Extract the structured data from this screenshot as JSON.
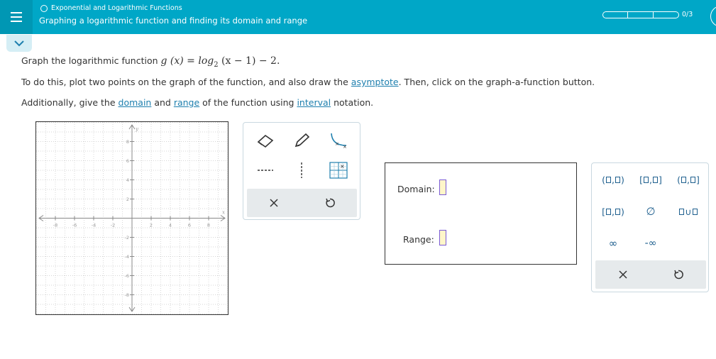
{
  "header": {
    "topic": "Exponential and Logarithmic Functions",
    "title": "Graphing a logarithmic function and finding its domain and range",
    "progress": "0/3"
  },
  "problem": {
    "line1_prefix": "Graph the logarithmic function ",
    "line1_func": "g (x) = log",
    "line1_base": "2",
    "line1_rest": " (x − 1) − 2.",
    "line2_a": "To do this, plot two points on the graph of the function, and also draw the ",
    "line2_link": "asymptote",
    "line2_b": ". Then, click on the graph-a-function button.",
    "line3_a": "Additionally, give the ",
    "line3_link1": "domain",
    "line3_b": " and ",
    "line3_link2": "range",
    "line3_c": " of the function using ",
    "line3_link3": "interval",
    "line3_d": " notation."
  },
  "graph": {
    "x_label": "x",
    "y_label": "y",
    "x_ticks": [
      "-8",
      "-6",
      "-4",
      "-2",
      "2",
      "4",
      "6",
      "8"
    ],
    "y_ticks": [
      "8",
      "6",
      "4",
      "2",
      "-2",
      "-4",
      "-6",
      "-8"
    ]
  },
  "tools": {
    "icons": [
      "eraser-icon",
      "pencil-icon",
      "curve-icon",
      "dashed-line-icon",
      "vertical-dashed-line-icon",
      "graph-function-icon",
      "clear-icon",
      "undo-icon"
    ]
  },
  "answers": {
    "domain_label": "Domain:",
    "range_label": "Range:"
  },
  "keypad": {
    "k_open_open": "(",
    "k_sep": ",",
    "k_close_paren": ")",
    "k_close_bracket": "]",
    "k_open_bracket": "[",
    "k_empty": "∅",
    "k_union": "∪",
    "k_inf": "∞",
    "k_neginf": "-∞"
  }
}
